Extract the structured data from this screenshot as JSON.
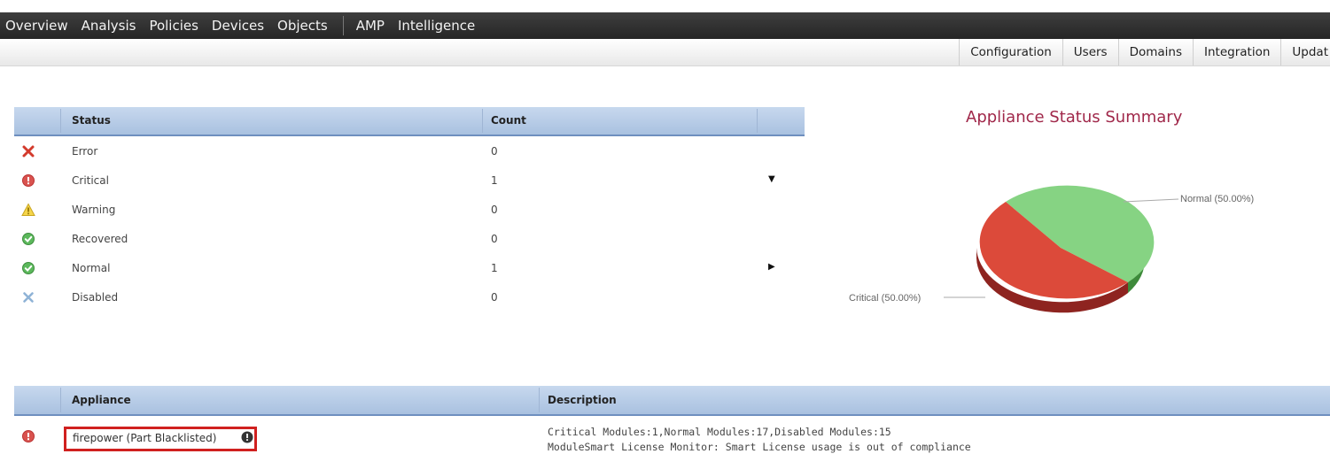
{
  "topnav": {
    "items": [
      "Overview",
      "Analysis",
      "Policies",
      "Devices",
      "Objects",
      "AMP",
      "Intelligence"
    ]
  },
  "subnav": {
    "tabs": [
      "Configuration",
      "Users",
      "Domains",
      "Integration",
      "Updat"
    ]
  },
  "status_table": {
    "headers": {
      "status": "Status",
      "count": "Count"
    },
    "rows": [
      {
        "icon": "error-x-icon",
        "label": "Error",
        "count": "0"
      },
      {
        "icon": "critical-icon",
        "label": "Critical",
        "count": "1",
        "arrow": "▼"
      },
      {
        "icon": "warning-icon",
        "label": "Warning",
        "count": "0"
      },
      {
        "icon": "recovered-check-icon",
        "label": "Recovered",
        "count": "0"
      },
      {
        "icon": "normal-check-icon",
        "label": "Normal",
        "count": "1",
        "arrow": "▶"
      },
      {
        "icon": "disabled-x-icon",
        "label": "Disabled",
        "count": "0"
      }
    ]
  },
  "chart": {
    "title": "Appliance Status Summary",
    "label_normal": "Normal (50.00%)",
    "label_critical": "Critical (50.00%)"
  },
  "chart_data": {
    "type": "pie",
    "title": "Appliance Status Summary",
    "slices": [
      {
        "name": "Normal",
        "value": 50.0,
        "color": "#86d383"
      },
      {
        "name": "Critical",
        "value": 50.0,
        "color": "#dc4a3a"
      }
    ]
  },
  "appliance_table": {
    "headers": {
      "appliance": "Appliance",
      "description": "Description"
    },
    "rows": [
      {
        "icon": "critical-icon",
        "name": "firepower  (Part Blacklisted)",
        "description_line1": "Critical Modules:1,Normal Modules:17,Disabled Modules:15",
        "description_line2": "ModuleSmart License Monitor: Smart License usage is out of compliance"
      }
    ]
  },
  "colors": {
    "nav_bg": "#2e2e2e",
    "header_blue": "#b8cce6",
    "chart_title": "#a0284a",
    "highlight_red": "#d0201f"
  }
}
